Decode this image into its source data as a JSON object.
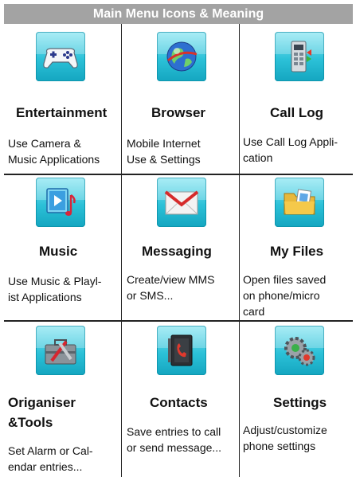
{
  "header": {
    "title": "Main Menu Icons & Meaning"
  },
  "items": [
    {
      "icon": "gamepad-icon",
      "title": "Entertainment",
      "desc_lines": [
        "Use Camera &",
        "Music Applications"
      ]
    },
    {
      "icon": "globe-icon",
      "title": "Browser",
      "desc_lines": [
        "Mobile Internet",
        "Use & Settings"
      ]
    },
    {
      "icon": "call-log-icon",
      "title": "Call Log",
      "desc_lines": [
        "Use Call Log Appli-",
        "cation"
      ]
    },
    {
      "icon": "music-icon",
      "title": "Music",
      "desc_lines": [
        "Use Music & Playl-",
        "ist Applications"
      ]
    },
    {
      "icon": "envelope-icon",
      "title": "Messaging",
      "desc_lines": [
        "Create/view MMS",
        "or SMS..."
      ]
    },
    {
      "icon": "folder-icon",
      "title": "My Files",
      "desc_lines": [
        "Open files saved",
        "on phone/micro",
        "card"
      ]
    },
    {
      "icon": "toolbox-icon",
      "title": "Origaniser",
      "title_line2": "&Tools",
      "desc_lines": [
        "Set Alarm or Cal-",
        "endar entries..."
      ]
    },
    {
      "icon": "phonebook-icon",
      "title": "Contacts",
      "desc_lines": [
        "Save entries to call",
        "or send message..."
      ]
    },
    {
      "icon": "gears-icon",
      "title": "Settings",
      "desc_lines": [
        "Adjust/customize",
        "phone settings"
      ]
    }
  ]
}
